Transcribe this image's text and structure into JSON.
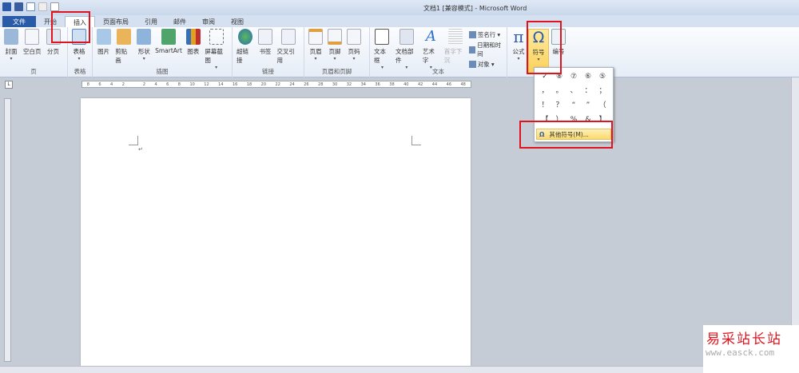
{
  "title": "文档1 [兼容模式] - Microsoft Word",
  "tabs": [
    "文件",
    "开始",
    "插入",
    "页面布局",
    "引用",
    "邮件",
    "审阅",
    "视图"
  ],
  "groups": [
    {
      "label": "页",
      "buttons": [
        "封面",
        "空白页",
        "分页"
      ]
    },
    {
      "label": "表格",
      "buttons": [
        "表格"
      ]
    },
    {
      "label": "插图",
      "buttons": [
        "图片",
        "剪贴画",
        "形状",
        "SmartArt",
        "图表",
        "屏幕截图"
      ]
    },
    {
      "label": "链接",
      "buttons": [
        "超链接",
        "书签",
        "交叉引用"
      ]
    },
    {
      "label": "页眉和页脚",
      "buttons": [
        "页眉",
        "页脚",
        "页码"
      ]
    },
    {
      "label": "文本",
      "buttons": [
        "文本框",
        "文档部件",
        "艺术字",
        "首字下沉"
      ],
      "small": [
        "签名行",
        "日期和时间",
        "对象"
      ]
    },
    {
      "label": "",
      "buttons": [
        "公式",
        "符号",
        "编号"
      ]
    }
  ],
  "ruler": [
    "8",
    "6",
    "4",
    "2",
    "",
    "2",
    "4",
    "6",
    "8",
    "10",
    "12",
    "14",
    "16",
    "18",
    "20",
    "22",
    "24",
    "26",
    "28",
    "30",
    "32",
    "34",
    "36",
    "38",
    "40",
    "42",
    "44",
    "46",
    "48"
  ],
  "symbols": [
    "✓",
    "⑧",
    "⑦",
    "⑥",
    "⑤",
    "，",
    "。",
    "、",
    "：",
    "；",
    "！",
    "？",
    "“",
    "”",
    "（",
    "【",
    "）",
    "%",
    "&",
    "】"
  ],
  "more_symbols": "其他符号(M)...",
  "watermark": {
    "name": "易采站长站",
    "url": "www.easck.com"
  },
  "colors": {
    "highlight": "#e0141e",
    "file_tab": "#2a5ba8"
  }
}
